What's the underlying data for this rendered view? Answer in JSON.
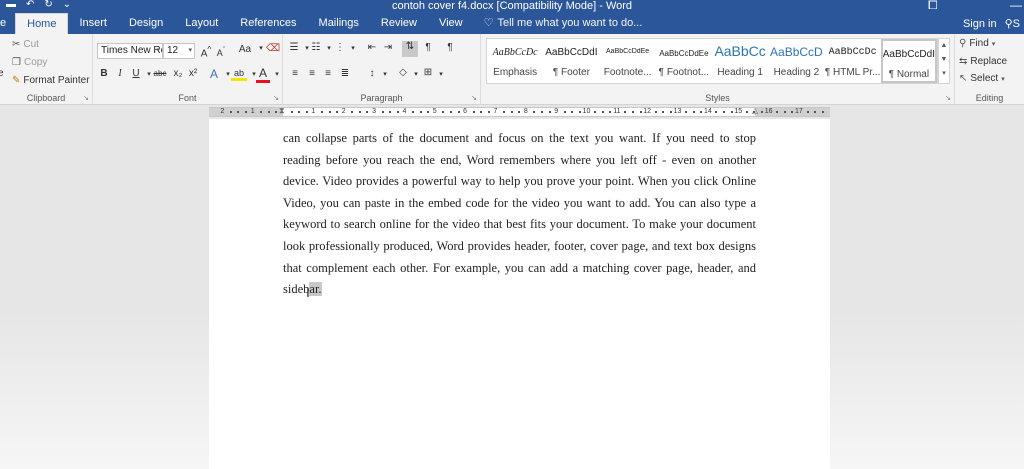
{
  "window": {
    "title": "contoh cover f4.docx [Compatibility Mode] - Word",
    "qat_icons": [
      "save-icon",
      "undo-icon",
      "redo-icon",
      "customize-qat-icon"
    ]
  },
  "tabs": [
    "e",
    "Home",
    "Insert",
    "Design",
    "Layout",
    "References",
    "Mailings",
    "Review",
    "View"
  ],
  "active_tab": "Home",
  "tell_me": "Tell me what you want to do...",
  "sign_in": "Sign in",
  "share_glyph": "S",
  "clipboard": {
    "label": "Clipboard",
    "paste_glyph": "e",
    "cut": "Cut",
    "copy": "Copy",
    "format_painter": "Format Painter"
  },
  "font": {
    "label": "Font",
    "family": "Times New Ro",
    "size": "12",
    "grow": "A",
    "shrink": "A",
    "case": "Aa",
    "bold": "B",
    "italic": "I",
    "underline": "U",
    "strike": "abc",
    "subscript": "x₂",
    "superscript": "x²",
    "effects": "A",
    "highlight": "ab",
    "color": "A"
  },
  "paragraph": {
    "label": "Paragraph"
  },
  "styles": {
    "label": "Styles",
    "items": [
      {
        "sample": "AaBbCcDc",
        "name": "Emphasis"
      },
      {
        "sample": "AaBbCcDdI",
        "name": "¶ Footer"
      },
      {
        "sample": "AaBbCcDdEe",
        "name": "Footnote..."
      },
      {
        "sample": "AaBbCcDdEe",
        "name": "¶ Footnot..."
      },
      {
        "sample": "AaBbCc",
        "name": "Heading 1"
      },
      {
        "sample": "AaBbCcD",
        "name": "Heading 2"
      },
      {
        "sample": "AaBbCcDc",
        "name": "¶ HTML Pr..."
      },
      {
        "sample": "AaBbCcDdI",
        "name": "¶ Normal"
      }
    ]
  },
  "editing": {
    "label": "Editing",
    "find": "Find",
    "replace": "Replace",
    "select": "Select"
  },
  "ruler": {
    "left_numbers": [
      "2",
      "1"
    ],
    "numbers": [
      "1",
      "2",
      "3",
      "4",
      "5",
      "6",
      "7",
      "8",
      "9",
      "10",
      "11",
      "12",
      "13",
      "14",
      "15",
      "16",
      "17",
      "18"
    ]
  },
  "document": {
    "lines": [
      "can collapse parts of the document and focus on the text you want. If you need to stop",
      "reading before you reach the end, Word remembers where you left off - even on another",
      "device. Video provides a powerful way to help you prove your point. When you click Online",
      "Video, you can paste in the embed code for the video you want to add. You can also type a",
      "keyword to search online for the video that best fits your document. To make your document",
      "look professionally produced, Word provides header, footer, cover page, and text box designs",
      "that complement each other. For example, you can add a matching cover page, header, and"
    ],
    "last_line_before": "sideb",
    "last_line_selected": "ar."
  }
}
